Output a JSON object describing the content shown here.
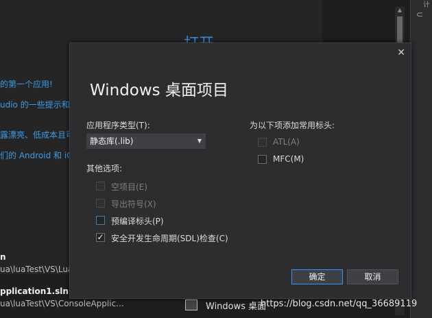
{
  "background": {
    "start_title": "打开",
    "links": [
      "的第一个应用!",
      "udio 的一些提示和",
      "露漂亮、低成本且可",
      "们的 Android 和 iO"
    ],
    "recent": [
      {
        "name": "n",
        "path": "ua\\luaTest\\VS\\Lua"
      },
      {
        "name": "pplication1.sln",
        "path": "ua\\luaTest\\VS\\ConsoleApplic..."
      }
    ],
    "template_label": "Windows 桌面",
    "right_panel_text": "计",
    "right_panel_toggle": "⊂"
  },
  "dialog": {
    "close_glyph": "✕",
    "title": "Windows 桌面项目",
    "app_type_label": "应用程序类型(T):",
    "app_type_value": "静态库(.lib)",
    "other_options_label": "其他选项:",
    "options": [
      {
        "label": "空项目(E)",
        "checked": false,
        "enabled": false
      },
      {
        "label": "导出符号(X)",
        "checked": false,
        "enabled": false
      },
      {
        "label": "预编译标头(P)",
        "checked": false,
        "enabled": true
      },
      {
        "label": "安全开发生命周期(SDL)检查(C)",
        "checked": true,
        "enabled": true
      }
    ],
    "headers_label": "为以下项添加常用标头:",
    "headers": [
      {
        "label": "ATL(A)",
        "checked": false,
        "enabled": false
      },
      {
        "label": "MFC(M)",
        "checked": false,
        "enabled": true
      }
    ],
    "ok_label": "确定",
    "cancel_label": "取消"
  },
  "watermark": "https://blog.csdn.net/qq_36689119",
  "colors": {
    "accent": "#3399ff",
    "link": "#3c9ce6",
    "dialog_bg": "#2d2d30"
  }
}
